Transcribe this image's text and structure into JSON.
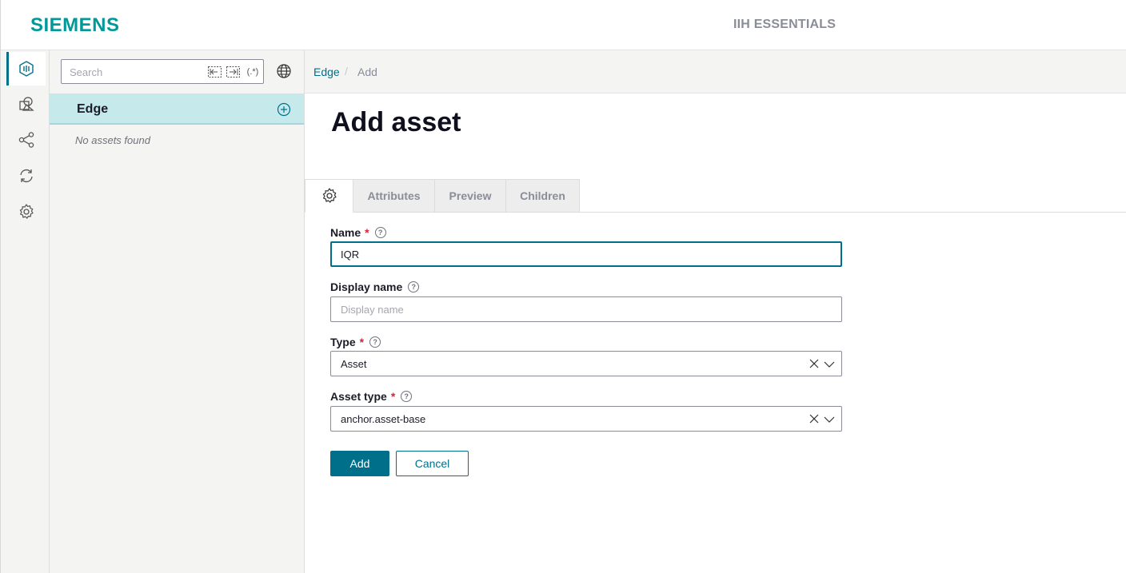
{
  "header": {
    "brand": "SIEMENS",
    "app_title": "IIH ESSENTIALS"
  },
  "rail": {
    "items": [
      {
        "name": "assets",
        "icon": "asset-model-icon",
        "active": true
      },
      {
        "name": "shapes",
        "icon": "shapes-icon",
        "active": false
      },
      {
        "name": "connections",
        "icon": "share-nodes-icon",
        "active": false
      },
      {
        "name": "sync",
        "icon": "sync-icon",
        "active": false
      },
      {
        "name": "settings",
        "icon": "gear-icon",
        "active": false
      }
    ]
  },
  "tree": {
    "search_placeholder": "Search",
    "search_icons": [
      "collapse-icon",
      "expand-icon",
      "regex-icon"
    ],
    "regex_label": "(.*)",
    "root_label": "Edge",
    "empty_text": "No assets found"
  },
  "breadcrumb": {
    "link": "Edge",
    "separator": "/",
    "current": "Add"
  },
  "page": {
    "title": "Add asset"
  },
  "tabs": [
    {
      "label": "Attributes"
    },
    {
      "label": "Preview"
    },
    {
      "label": "Children"
    }
  ],
  "form": {
    "name": {
      "label": "Name",
      "required_mark": "*",
      "help": "?",
      "value": "IQR"
    },
    "display_name": {
      "label": "Display name",
      "help": "?",
      "value": "",
      "placeholder": "Display name"
    },
    "type": {
      "label": "Type",
      "required_mark": "*",
      "help": "?",
      "value": "Asset"
    },
    "asset_type": {
      "label": "Asset type",
      "required_mark": "*",
      "help": "?",
      "value": "anchor.asset-base"
    }
  },
  "actions": {
    "add_label": "Add",
    "cancel_label": "Cancel"
  },
  "colors": {
    "brand": "#009999",
    "accent": "#00708a",
    "selected_row": "#c6e9ec",
    "required": "#d72339"
  }
}
